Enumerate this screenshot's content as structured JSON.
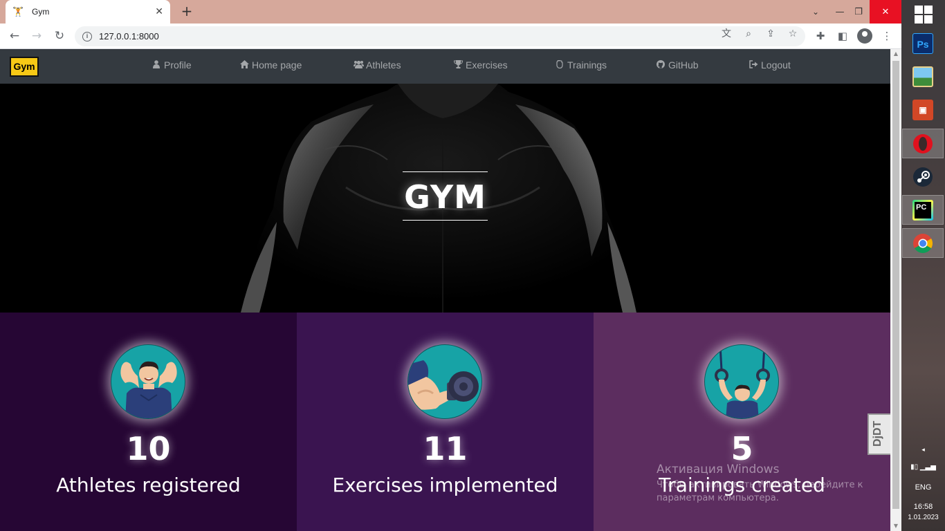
{
  "browser": {
    "tab_title": "Gym",
    "tab_close": "✕",
    "new_tab": "+",
    "url": "127.0.0.1:8000",
    "controls": {
      "minimize": "—",
      "maximize": "❐",
      "close": "✕"
    }
  },
  "site": {
    "logo": "Gym",
    "nav": [
      {
        "label": "Profile",
        "icon": "user-icon"
      },
      {
        "label": "Home page",
        "icon": "home-icon"
      },
      {
        "label": "Athletes",
        "icon": "users-icon"
      },
      {
        "label": "Exercises",
        "icon": "trophy-icon"
      },
      {
        "label": "Trainings",
        "icon": "hand-icon"
      },
      {
        "label": "GitHub",
        "icon": "github-icon"
      },
      {
        "label": "Logout",
        "icon": "logout-icon"
      }
    ],
    "hero_title": "GYM",
    "stats": [
      {
        "value": "10",
        "label": "Athletes registered",
        "bg": "#260634",
        "illustration": "flexing-athlete"
      },
      {
        "value": "11",
        "label": "Exercises implemented",
        "bg": "#3a1450",
        "illustration": "arm-dumbbell"
      },
      {
        "value": "5",
        "label": "Trainings created",
        "bg": "#5c2d5f",
        "illustration": "rings-athlete"
      }
    ]
  },
  "overlays": {
    "activation_title": "Активация Windows",
    "activation_text": "Чтобы активировать Windows, перейдите к параметрам компьютера.",
    "djdt": "DjDT"
  },
  "taskbar": {
    "apps": [
      {
        "name": "Photoshop",
        "text": "Ps",
        "color": "#0a2c6b",
        "fg": "#31a8ff"
      },
      {
        "name": "Photos",
        "text": "",
        "color": "#3a8fd6",
        "fg": "#fff"
      },
      {
        "name": "PowerPoint",
        "text": "",
        "color": "#d24726",
        "fg": "#fff"
      },
      {
        "name": "Opera",
        "text": "",
        "color": "#e0111e",
        "fg": "#fff"
      },
      {
        "name": "Steam",
        "text": "",
        "color": "#1b2838",
        "fg": "#fff"
      },
      {
        "name": "PyCharm",
        "text": "PC",
        "color": "#000000",
        "fg": "#fff"
      },
      {
        "name": "Chrome",
        "text": "",
        "color": "#ffffff",
        "fg": "#fff"
      }
    ],
    "lang": "ENG",
    "time": "16:58",
    "date": "1.01.2023"
  }
}
